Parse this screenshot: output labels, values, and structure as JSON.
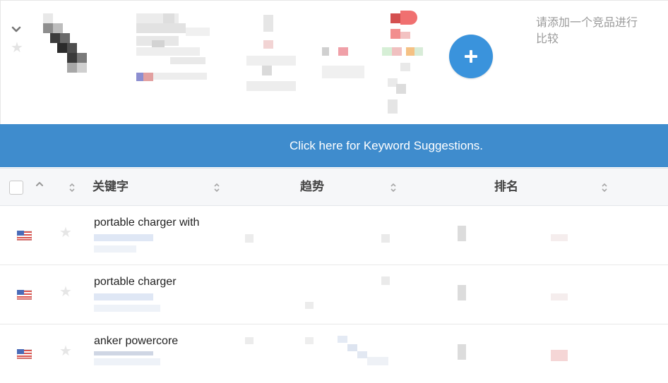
{
  "compare": {
    "add_hint": "请添加一个竞品进行比较"
  },
  "banner": {
    "label": "Click here for Keyword Suggestions."
  },
  "table": {
    "columns": [
      {
        "label": "关键字"
      },
      {
        "label": "趋势"
      },
      {
        "label": "排名"
      }
    ],
    "rows": [
      {
        "keyword": "portable charger with",
        "country": "US"
      },
      {
        "keyword": "portable charger",
        "country": "US"
      },
      {
        "keyword": "anker powercore",
        "country": "US"
      }
    ]
  },
  "colors": {
    "accent": "#3a93dc",
    "banner": "#3f8ccd",
    "header_bg": "#f6f7f9"
  },
  "icons": [
    "chevron-down-icon",
    "star-icon",
    "plus-icon",
    "sort-icon",
    "us-flag-icon",
    "chevron-up-icon"
  ]
}
